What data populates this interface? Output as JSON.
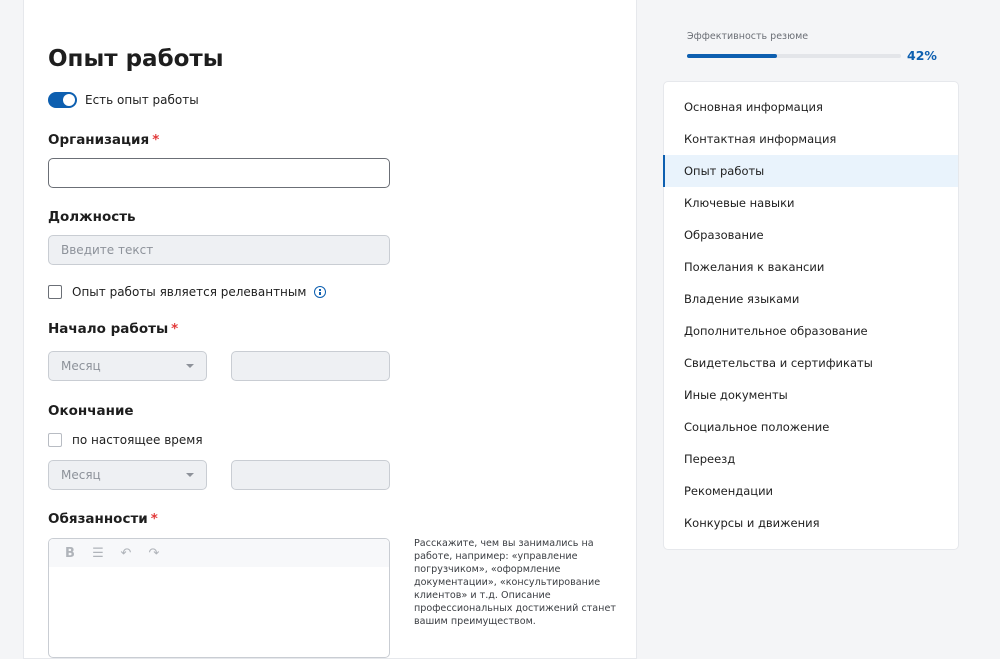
{
  "section": {
    "title": "Опыт работы",
    "toggle_label": "Есть опыт работы",
    "toggle_on": true
  },
  "organization": {
    "label": "Организация",
    "required_mark": "*",
    "value": ""
  },
  "position": {
    "label": "Должность",
    "placeholder": "Введите текст"
  },
  "relevant": {
    "label": "Опыт работы является релевантным",
    "checked": false
  },
  "start": {
    "label": "Начало работы",
    "required_mark": "*",
    "month_placeholder": "Месяц",
    "year_value": ""
  },
  "end": {
    "label": "Окончание",
    "present_label": "по настоящее время",
    "present_checked": false,
    "month_placeholder": "Месяц",
    "year_value": ""
  },
  "duties": {
    "label": "Обязанности",
    "required_mark": "*",
    "hint": "Расскажите, чем вы занимались на работе, например: «управление погрузчиком», «оформление документации», «консультирование клиентов» и т.д. Описание профессиональных достижений станет вашим преимуществом."
  },
  "efficiency": {
    "label": "Эффективность резюме",
    "percent_text": "42%",
    "percent": 42,
    "accent": "#0d5fb0"
  },
  "nav": {
    "items": [
      {
        "label": "Основная информация",
        "active": false
      },
      {
        "label": "Контактная информация",
        "active": false
      },
      {
        "label": "Опыт работы",
        "active": true
      },
      {
        "label": "Ключевые навыки",
        "active": false
      },
      {
        "label": "Образование",
        "active": false
      },
      {
        "label": "Пожелания к вакансии",
        "active": false
      },
      {
        "label": "Владение языками",
        "active": false
      },
      {
        "label": "Дополнительное образование",
        "active": false
      },
      {
        "label": "Свидетельства и сертификаты",
        "active": false
      },
      {
        "label": "Иные документы",
        "active": false
      },
      {
        "label": "Социальное положение",
        "active": false
      },
      {
        "label": "Переезд",
        "active": false
      },
      {
        "label": "Рекомендации",
        "active": false
      },
      {
        "label": "Конкурсы и движения",
        "active": false
      }
    ]
  },
  "icons": {
    "bold": "bold-icon",
    "list": "bullet-list-icon",
    "undo": "undo-icon",
    "redo": "redo-icon",
    "info": "info-icon",
    "caret": "chevron-down-icon"
  }
}
